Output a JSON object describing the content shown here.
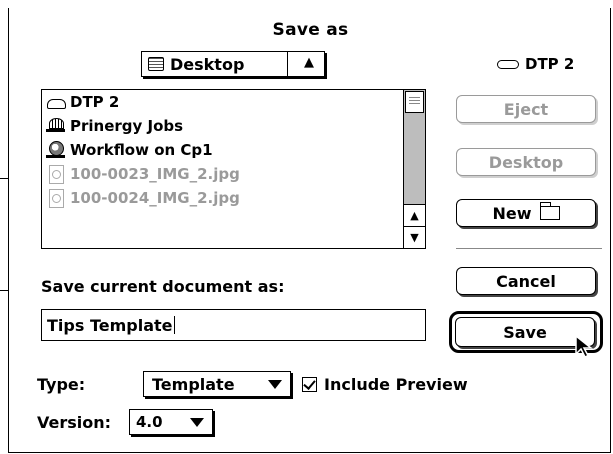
{
  "dialog": {
    "title": "Save as"
  },
  "location_popup": {
    "selected": "Desktop",
    "icon": "desktop-icon"
  },
  "volume": {
    "name": "DTP 2",
    "icon": "disk-icon"
  },
  "file_list": {
    "items": [
      {
        "name": "DTP 2",
        "icon": "hard-drive-icon",
        "enabled": true
      },
      {
        "name": "Prinergy Jobs",
        "icon": "network-volume-icon",
        "enabled": true
      },
      {
        "name": "Workflow on Cp1",
        "icon": "globe-server-icon",
        "enabled": true
      },
      {
        "name": "100-0023_IMG_2.jpg",
        "icon": "jpeg-document-icon",
        "enabled": false
      },
      {
        "name": "100-0024_IMG_2.jpg",
        "icon": "jpeg-document-icon",
        "enabled": false
      }
    ]
  },
  "buttons": {
    "eject": "Eject",
    "desktop": "Desktop",
    "new": "New",
    "cancel": "Cancel",
    "save": "Save"
  },
  "save_as": {
    "label": "Save current document as:",
    "value": "Tips Template"
  },
  "type": {
    "label": "Type:",
    "selected": "Template"
  },
  "include_preview": {
    "label": "Include Preview",
    "checked": true
  },
  "version": {
    "label": "Version:",
    "selected": "4.0"
  }
}
